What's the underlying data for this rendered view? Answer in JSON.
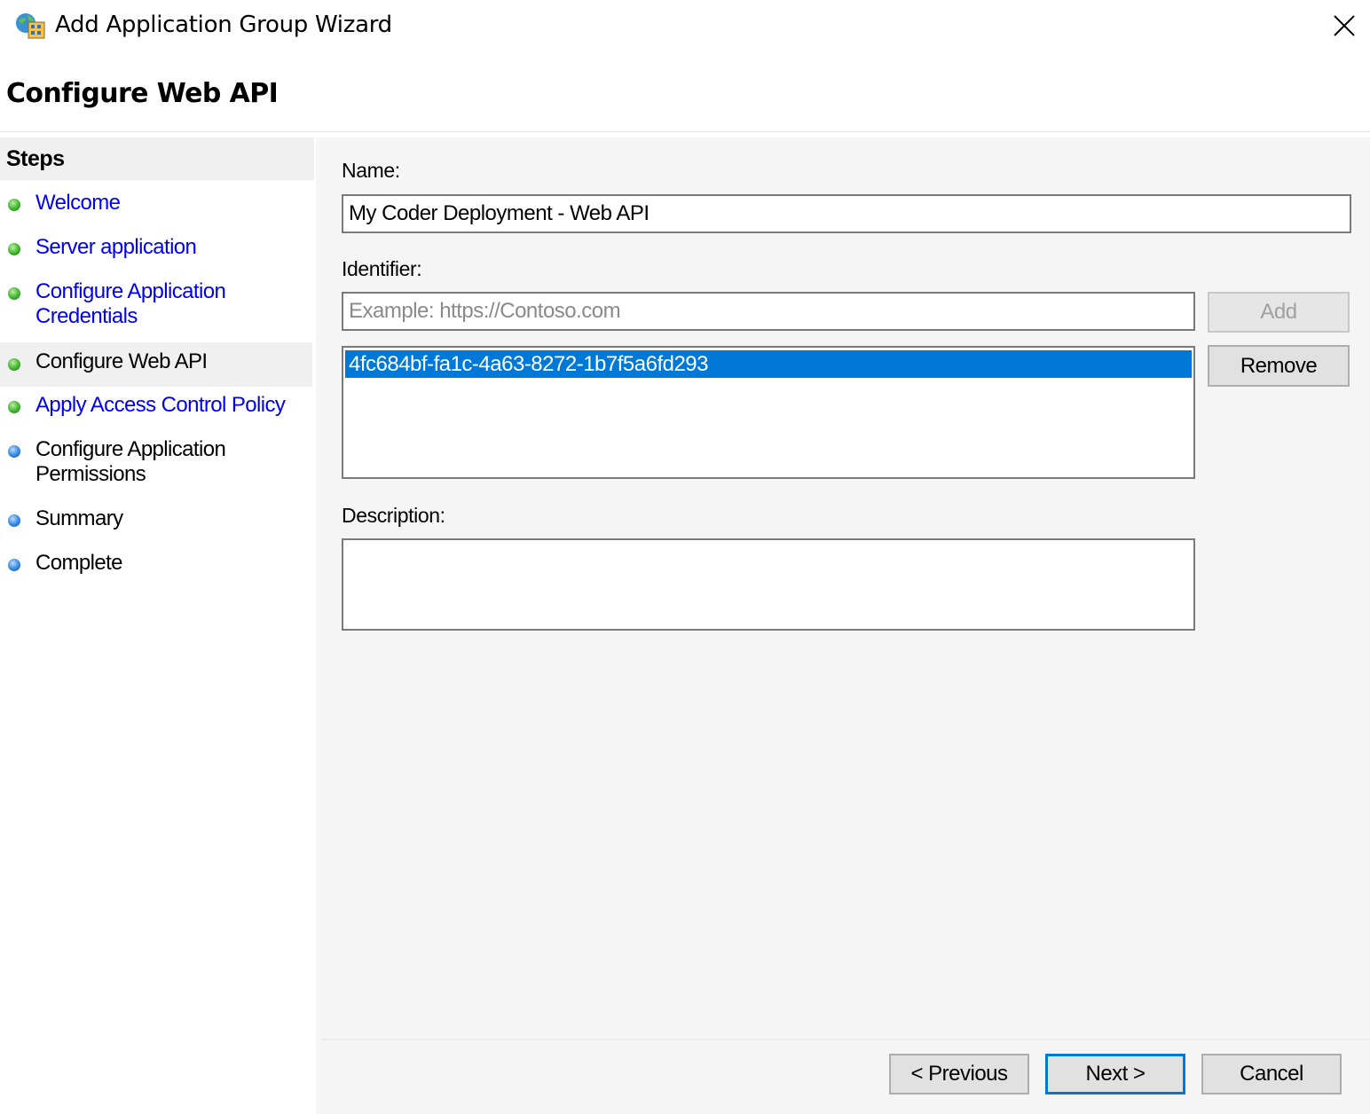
{
  "window": {
    "title": "Add Application Group Wizard",
    "app_icon": "application-group-icon",
    "close_icon": "close-icon"
  },
  "page": {
    "title": "Configure Web API"
  },
  "sidebar": {
    "header": "Steps",
    "items": [
      {
        "label": "Welcome",
        "status": "complete",
        "link": true
      },
      {
        "label": "Server application",
        "status": "complete",
        "link": true
      },
      {
        "label": "Configure Application Credentials",
        "label_line1": "Configure Application",
        "label_line2": "Credentials",
        "status": "complete",
        "link": true
      },
      {
        "label": "Configure Web API",
        "status": "current",
        "link": false
      },
      {
        "label": "Apply Access Control Policy",
        "status": "complete",
        "link": true
      },
      {
        "label": "Configure Application Permissions",
        "label_line1": "Configure Application",
        "label_line2": "Permissions",
        "status": "pending",
        "link": false
      },
      {
        "label": "Summary",
        "status": "pending",
        "link": false
      },
      {
        "label": "Complete",
        "status": "pending",
        "link": false
      }
    ],
    "colors": {
      "complete": "#3fb22c",
      "pending": "#2f86e0",
      "link": "#0000ee"
    }
  },
  "form": {
    "name_label": "Name:",
    "name_value": "My Coder Deployment - Web API",
    "identifier_label": "Identifier:",
    "identifier_placeholder": "Example: https://Contoso.com",
    "identifier_value": "",
    "add_label": "Add",
    "remove_label": "Remove",
    "identifiers": [
      "4fc684bf-fa1c-4a63-8272-1b7f5a6fd293"
    ],
    "description_label": "Description:",
    "description_value": ""
  },
  "footer": {
    "previous_label": "< Previous",
    "next_label": "Next >",
    "cancel_label": "Cancel"
  },
  "colors": {
    "selection": "#0078d7",
    "default_button_border": "#0078d7"
  }
}
